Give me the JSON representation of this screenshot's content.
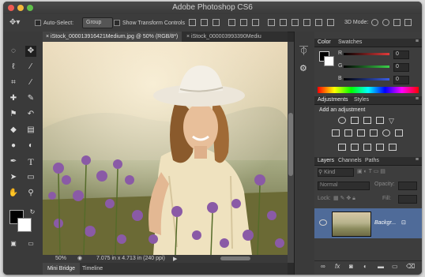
{
  "app": {
    "title": "Adobe Photoshop CS6"
  },
  "options_bar": {
    "auto_select_label": "Auto-Select:",
    "auto_select_value": "Group",
    "show_transform_label": "Show Transform Controls",
    "mode_label": "3D Mode:"
  },
  "document_tabs": [
    {
      "label": "iStock_000013916421Medium.jpg @ 50% (RGB/8*)",
      "active": true
    },
    {
      "label": "iStock_000003993390Mediu",
      "active": false
    }
  ],
  "status": {
    "zoom": "50%",
    "doc_info": "7.075 in x 4.713 in (240 ppi)"
  },
  "bottom_tabs": [
    "Mini Bridge",
    "Timeline"
  ],
  "panels": {
    "color": {
      "tabs": [
        "Color",
        "Swatches"
      ],
      "channels": [
        {
          "label": "R",
          "value": "0",
          "color": "#e23b3b"
        },
        {
          "label": "G",
          "value": "0",
          "color": "#3bd14a"
        },
        {
          "label": "B",
          "value": "0",
          "color": "#3b5de2"
        }
      ]
    },
    "adjustments": {
      "tabs": [
        "Adjustments",
        "Styles"
      ],
      "heading": "Add an adjustment"
    },
    "layers": {
      "tabs": [
        "Layers",
        "Channels",
        "Paths"
      ],
      "kind_label": "Kind",
      "blend_mode": "Normal",
      "opacity_label": "Opacity:",
      "lock_label": "Lock:",
      "fill_label": "Fill:",
      "layer_name": "Backgr..."
    }
  },
  "colors": {
    "accent_selected": "#4f6b99"
  },
  "icons": {
    "tools": [
      "move-tool-icon",
      "marquee-tool-icon",
      "lasso-tool-icon",
      "quick-select-tool-icon",
      "crop-tool-icon",
      "eyedropper-tool-icon",
      "spot-healing-tool-icon",
      "brush-tool-icon",
      "clone-stamp-tool-icon",
      "history-brush-tool-icon",
      "eraser-tool-icon",
      "gradient-tool-icon",
      "blur-tool-icon",
      "dodge-tool-icon",
      "pen-tool-icon",
      "type-tool-icon",
      "path-select-tool-icon",
      "shape-tool-icon",
      "hand-tool-icon",
      "zoom-tool-icon"
    ]
  }
}
